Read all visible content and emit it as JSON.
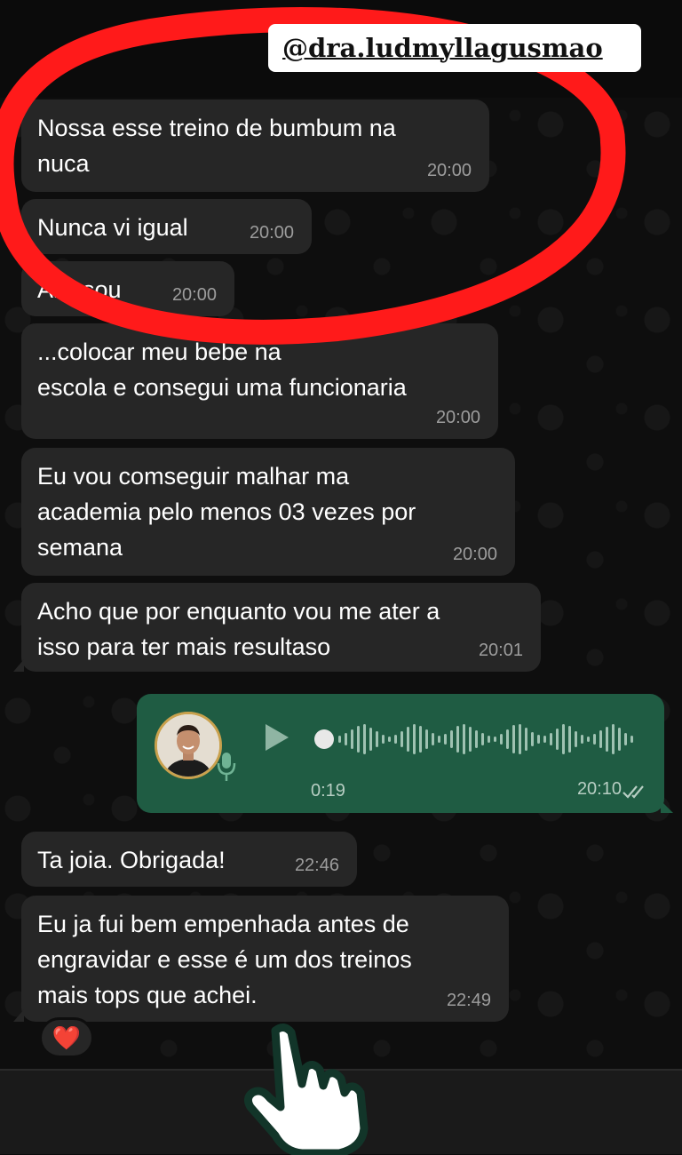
{
  "overlay": {
    "handle": "@dra.ludmyllagusmao",
    "hand_icon": "pointing-hand-icon",
    "highlight_color": "#ff1a1a"
  },
  "messages": [
    {
      "text": "Nossa esse treino de bumbum na\nnuca",
      "time": "20:00"
    },
    {
      "text": "Nunca vi igual",
      "time": "20:00"
    },
    {
      "text": "Arrasou",
      "time": "20:00"
    },
    {
      "text": "...colocar meu bebe na\nescola e consegui uma funcionaria",
      "time": "20:00"
    },
    {
      "text": "Eu vou comseguir malhar ma\nacademia pelo menos 03 vezes por\nsemana",
      "time": "20:00"
    },
    {
      "text": "Acho que por enquanto vou me ater a\nisso para ter mais resultaso",
      "time": "20:01"
    },
    {
      "text": "Ta joia. Obrigada!",
      "time": "22:46"
    },
    {
      "text": "Eu ja fui bem empenhada antes de\nengravidar e esse é um dos treinos\nmais tops que achei.",
      "time": "22:49"
    }
  ],
  "voice_message": {
    "duration": "0:19",
    "time": "20:10",
    "status": "read",
    "icons": [
      "play-icon",
      "mic-icon",
      "double-check-icon"
    ]
  },
  "reaction": {
    "emoji": "❤️"
  },
  "colors": {
    "incoming_bubble": "#262626",
    "outgoing_bubble": "#1f5c43",
    "background": "#0e0e0e"
  }
}
